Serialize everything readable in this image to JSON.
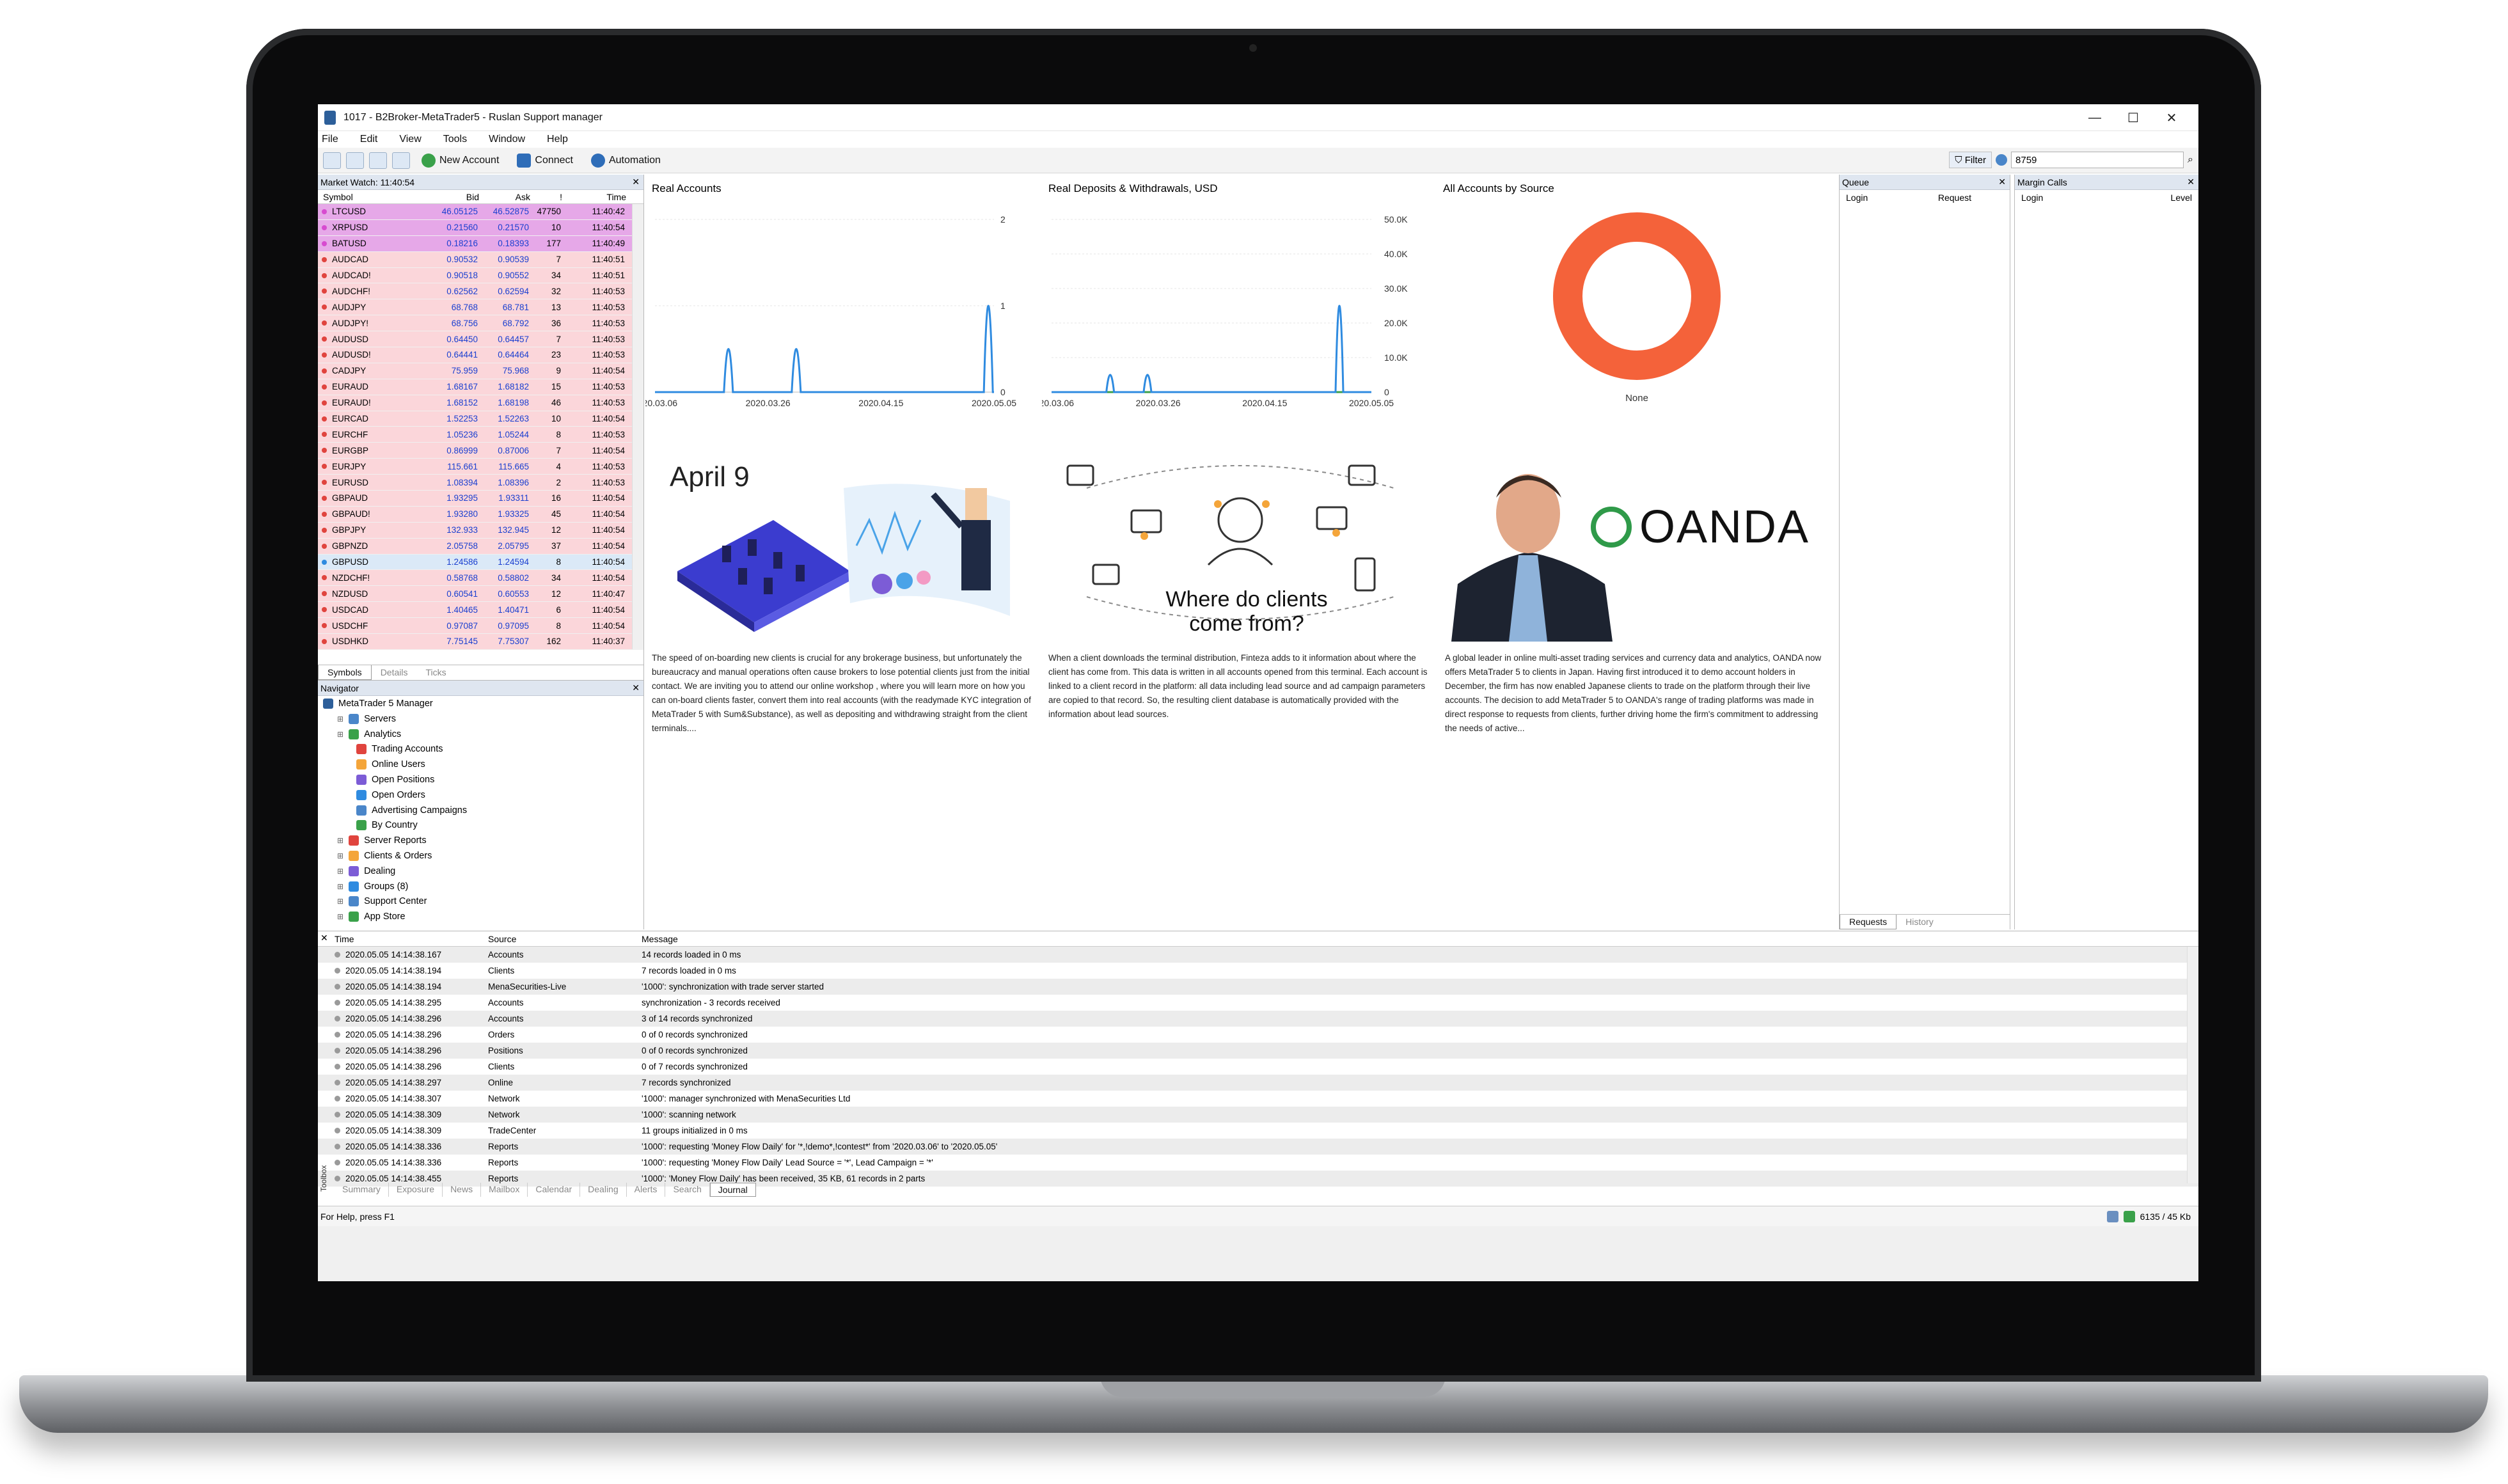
{
  "window": {
    "title": "1017 - B2Broker-MetaTrader5 - Ruslan Support manager"
  },
  "menu": [
    "File",
    "Edit",
    "View",
    "Tools",
    "Window",
    "Help"
  ],
  "toolbar": {
    "new_account": "New Account",
    "connect": "Connect",
    "automation": "Automation",
    "filter_label": "Filter",
    "filter_value": "8759"
  },
  "market_watch": {
    "title": "Market Watch: 11:40:54",
    "columns": [
      "Symbol",
      "Bid",
      "Ask",
      "!",
      "Time"
    ],
    "rows": [
      {
        "symbol": "LTCUSD",
        "bid": "46.05125",
        "ask": "46.52875",
        "spread": "47750",
        "time": "11:40:42",
        "hl": "#e6a8e8"
      },
      {
        "symbol": "XRPUSD",
        "bid": "0.21560",
        "ask": "0.21570",
        "spread": "10",
        "time": "11:40:54",
        "hl": "#e6a8e8"
      },
      {
        "symbol": "BATUSD",
        "bid": "0.18216",
        "ask": "0.18393",
        "spread": "177",
        "time": "11:40:49",
        "hl": "#e6a8e8"
      },
      {
        "symbol": "AUDCAD",
        "bid": "0.90532",
        "ask": "0.90539",
        "spread": "7",
        "time": "11:40:51",
        "hl": "#fbd6da"
      },
      {
        "symbol": "AUDCAD!",
        "bid": "0.90518",
        "ask": "0.90552",
        "spread": "34",
        "time": "11:40:51",
        "hl": "#fbd6da"
      },
      {
        "symbol": "AUDCHF!",
        "bid": "0.62562",
        "ask": "0.62594",
        "spread": "32",
        "time": "11:40:53",
        "hl": "#fbd6da"
      },
      {
        "symbol": "AUDJPY",
        "bid": "68.768",
        "ask": "68.781",
        "spread": "13",
        "time": "11:40:53",
        "hl": "#fbd6da"
      },
      {
        "symbol": "AUDJPY!",
        "bid": "68.756",
        "ask": "68.792",
        "spread": "36",
        "time": "11:40:53",
        "hl": "#fbd6da"
      },
      {
        "symbol": "AUDUSD",
        "bid": "0.64450",
        "ask": "0.64457",
        "spread": "7",
        "time": "11:40:53",
        "hl": "#fbd6da"
      },
      {
        "symbol": "AUDUSD!",
        "bid": "0.64441",
        "ask": "0.64464",
        "spread": "23",
        "time": "11:40:53",
        "hl": "#fbd6da"
      },
      {
        "symbol": "CADJPY",
        "bid": "75.959",
        "ask": "75.968",
        "spread": "9",
        "time": "11:40:54",
        "hl": "#fbd6da"
      },
      {
        "symbol": "EURAUD",
        "bid": "1.68167",
        "ask": "1.68182",
        "spread": "15",
        "time": "11:40:53",
        "hl": "#fbd6da"
      },
      {
        "symbol": "EURAUD!",
        "bid": "1.68152",
        "ask": "1.68198",
        "spread": "46",
        "time": "11:40:53",
        "hl": "#fbd6da"
      },
      {
        "symbol": "EURCAD",
        "bid": "1.52253",
        "ask": "1.52263",
        "spread": "10",
        "time": "11:40:54",
        "hl": "#fbd6da"
      },
      {
        "symbol": "EURCHF",
        "bid": "1.05236",
        "ask": "1.05244",
        "spread": "8",
        "time": "11:40:53",
        "hl": "#fbd6da"
      },
      {
        "symbol": "EURGBP",
        "bid": "0.86999",
        "ask": "0.87006",
        "spread": "7",
        "time": "11:40:54",
        "hl": "#fbd6da"
      },
      {
        "symbol": "EURJPY",
        "bid": "115.661",
        "ask": "115.665",
        "spread": "4",
        "time": "11:40:53",
        "hl": "#fbd6da"
      },
      {
        "symbol": "EURUSD",
        "bid": "1.08394",
        "ask": "1.08396",
        "spread": "2",
        "time": "11:40:53",
        "hl": "#fbd6da"
      },
      {
        "symbol": "GBPAUD",
        "bid": "1.93295",
        "ask": "1.93311",
        "spread": "16",
        "time": "11:40:54",
        "hl": "#fbd6da"
      },
      {
        "symbol": "GBPAUD!",
        "bid": "1.93280",
        "ask": "1.93325",
        "spread": "45",
        "time": "11:40:54",
        "hl": "#fbd6da"
      },
      {
        "symbol": "GBPJPY",
        "bid": "132.933",
        "ask": "132.945",
        "spread": "12",
        "time": "11:40:54",
        "hl": "#fbd6da"
      },
      {
        "symbol": "GBPNZD",
        "bid": "2.05758",
        "ask": "2.05795",
        "spread": "37",
        "time": "11:40:54",
        "hl": "#fbd6da"
      },
      {
        "symbol": "GBPUSD",
        "bid": "1.24586",
        "ask": "1.24594",
        "spread": "8",
        "time": "11:40:54",
        "hl": "#dbe9f7"
      },
      {
        "symbol": "NZDCHF!",
        "bid": "0.58768",
        "ask": "0.58802",
        "spread": "34",
        "time": "11:40:54",
        "hl": "#fbd6da"
      },
      {
        "symbol": "NZDUSD",
        "bid": "0.60541",
        "ask": "0.60553",
        "spread": "12",
        "time": "11:40:47",
        "hl": "#fbd6da"
      },
      {
        "symbol": "USDCAD",
        "bid": "1.40465",
        "ask": "1.40471",
        "spread": "6",
        "time": "11:40:54",
        "hl": "#fbd6da"
      },
      {
        "symbol": "USDCHF",
        "bid": "0.97087",
        "ask": "0.97095",
        "spread": "8",
        "time": "11:40:54",
        "hl": "#fbd6da"
      },
      {
        "symbol": "USDHKD",
        "bid": "7.75145",
        "ask": "7.75307",
        "spread": "162",
        "time": "11:40:37",
        "hl": "#fbd6da"
      }
    ],
    "tabs": [
      "Symbols",
      "Details",
      "Ticks"
    ]
  },
  "navigator": {
    "title": "Navigator",
    "root": "MetaTrader 5 Manager",
    "items": [
      {
        "label": "Servers",
        "level": 1
      },
      {
        "label": "Analytics",
        "level": 1
      },
      {
        "label": "Trading Accounts",
        "level": 2
      },
      {
        "label": "Online Users",
        "level": 2
      },
      {
        "label": "Open Positions",
        "level": 2
      },
      {
        "label": "Open Orders",
        "level": 2
      },
      {
        "label": "Advertising Campaigns",
        "level": 2
      },
      {
        "label": "By Country",
        "level": 2
      },
      {
        "label": "Server Reports",
        "level": 1
      },
      {
        "label": "Clients & Orders",
        "level": 1
      },
      {
        "label": "Dealing",
        "level": 1
      },
      {
        "label": "Groups (8)",
        "level": 1
      },
      {
        "label": "Support Center",
        "level": 1
      },
      {
        "label": "App Store",
        "level": 1
      }
    ]
  },
  "dashboard": {
    "real_accounts_title": "Real Accounts",
    "deposits_title": "Real Deposits & Withdrawals, USD",
    "by_source_title": "All Accounts by Source",
    "donut_label": "None",
    "donut_color": "#f4623a",
    "articles": [
      {
        "heading": "April 9",
        "text": "The speed of on-boarding new clients is crucial for any brokerage business, but unfortunately the bureaucracy and manual operations often cause brokers to lose potential clients just from the initial contact. We are inviting you to attend our online workshop , where you will learn more on how you can on-board clients faster, convert them into real accounts (with the readymade KYC integration of MetaTrader 5 with Sum&Substance), as well as depositing and withdrawing straight from the client terminals...."
      },
      {
        "heading": "Where do clients come from?",
        "text": "When a client downloads the terminal distribution, Finteza adds to it information about where the client has come from. This data is written in all accounts opened from this terminal. Each account is linked to a client record in the platform: all data including lead source and ad campaign parameters are copied to that record. So, the resulting client database is automatically provided with the information about lead sources."
      },
      {
        "heading": "OANDA",
        "text": "A global leader in online multi-asset trading services and currency data and analytics, OANDA now offers MetaTrader 5 to clients in Japan. Having first introduced it to demo account holders in December, the firm has now enabled Japanese clients to trade on the platform through their live accounts. The decision to add MetaTrader 5 to OANDA's range of trading platforms was made in direct response to requests from clients, further driving home the firm's commitment to addressing the needs of active..."
      }
    ]
  },
  "chart_data": [
    {
      "type": "line",
      "title": "Real Accounts",
      "x": [
        "2020.03.06",
        "2020.03.26",
        "2020.04.15",
        "2020.05.05"
      ],
      "x_ticks": [
        "2020.03.06",
        "2020.03.26",
        "2020.04.15",
        "2020.05.05"
      ],
      "spikes": [
        {
          "x": "2020.03.19",
          "y": 1
        },
        {
          "x": "2020.03.31",
          "y": 1
        },
        {
          "x": "2020.05.04",
          "y": 2
        }
      ],
      "ylim": [
        0,
        2
      ],
      "y_ticks": [
        "0",
        "1",
        "2"
      ],
      "color": "#2f8be0"
    },
    {
      "type": "line",
      "title": "Real Deposits & Withdrawals, USD",
      "x_ticks": [
        "2020.03.06",
        "2020.03.26",
        "2020.04.15",
        "2020.05.05"
      ],
      "series": [
        {
          "values": [
            {
              "x": "2020.03.17",
              "y": 10000
            },
            {
              "x": "2020.03.24",
              "y": 10000
            },
            {
              "x": "2020.04.29",
              "y": 50000
            }
          ],
          "color": "#2f8be0"
        },
        {
          "values": [
            {
              "x": "2020.03.06",
              "y": 0
            },
            {
              "x": "2020.05.05",
              "y": 0
            }
          ],
          "color": "#3aa14a"
        }
      ],
      "ylim": [
        0,
        50000
      ],
      "y_ticks": [
        "0",
        "10.0K",
        "20.0K",
        "30.0K",
        "40.0K",
        "50.0K"
      ]
    },
    {
      "type": "pie",
      "title": "All Accounts by Source",
      "labels": [
        "None"
      ],
      "values": [
        100
      ],
      "colors": [
        "#f4623a"
      ]
    }
  ],
  "queue": {
    "title": "Queue",
    "columns": [
      "Login",
      "Request"
    ],
    "tabs": [
      "Requests",
      "History"
    ]
  },
  "margin_calls": {
    "title": "Margin Calls",
    "columns": [
      "Login",
      "Level"
    ]
  },
  "journal": {
    "columns": [
      "Time",
      "Source",
      "Message"
    ],
    "rows": [
      {
        "time": "2020.05.05 14:14:38.167",
        "source": "Accounts",
        "message": "14 records loaded in 0 ms"
      },
      {
        "time": "2020.05.05 14:14:38.194",
        "source": "Clients",
        "message": "7 records loaded in 0 ms"
      },
      {
        "time": "2020.05.05 14:14:38.194",
        "source": "MenaSecurities-Live",
        "message": "'1000': synchronization with trade server started"
      },
      {
        "time": "2020.05.05 14:14:38.295",
        "source": "Accounts",
        "message": "synchronization - 3 records received"
      },
      {
        "time": "2020.05.05 14:14:38.296",
        "source": "Accounts",
        "message": "3 of 14 records synchronized"
      },
      {
        "time": "2020.05.05 14:14:38.296",
        "source": "Orders",
        "message": "0 of 0 records synchronized"
      },
      {
        "time": "2020.05.05 14:14:38.296",
        "source": "Positions",
        "message": "0 of 0 records synchronized"
      },
      {
        "time": "2020.05.05 14:14:38.296",
        "source": "Clients",
        "message": "0 of 7 records synchronized"
      },
      {
        "time": "2020.05.05 14:14:38.297",
        "source": "Online",
        "message": "7 records synchronized"
      },
      {
        "time": "2020.05.05 14:14:38.307",
        "source": "Network",
        "message": "'1000': manager synchronized with MenaSecurities Ltd"
      },
      {
        "time": "2020.05.05 14:14:38.309",
        "source": "Network",
        "message": "'1000': scanning network"
      },
      {
        "time": "2020.05.05 14:14:38.309",
        "source": "TradeCenter",
        "message": "11 groups initialized in 0 ms"
      },
      {
        "time": "2020.05.05 14:14:38.336",
        "source": "Reports",
        "message": "'1000': requesting 'Money Flow Daily' for '*,!demo*,!contest*' from '2020.03.06' to '2020.05.05'"
      },
      {
        "time": "2020.05.05 14:14:38.336",
        "source": "Reports",
        "message": "'1000': requesting 'Money Flow Daily' Lead Source = '*', Lead Campaign = '*'"
      },
      {
        "time": "2020.05.05 14:14:38.455",
        "source": "Reports",
        "message": "'1000': 'Money Flow Daily' has been received, 35 KB, 61 records in 2 parts"
      }
    ],
    "tabs": [
      "Summary",
      "Exposure",
      "News",
      "Mailbox",
      "Calendar",
      "Dealing",
      "Alerts",
      "Search",
      "Journal"
    ],
    "toolbox_label": "Toolbox"
  },
  "status": {
    "help": "For Help, press F1",
    "traffic": "6135 / 45 Kb"
  }
}
